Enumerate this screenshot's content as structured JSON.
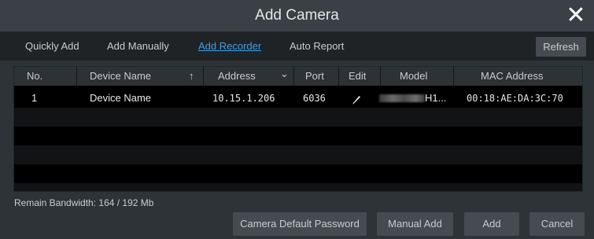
{
  "dialog": {
    "title": "Add Camera",
    "close_glyph": "✕"
  },
  "tabs": [
    {
      "label": "Quickly Add",
      "active": false
    },
    {
      "label": "Add Manually",
      "active": false
    },
    {
      "label": "Add Recorder",
      "active": true
    },
    {
      "label": "Auto Report",
      "active": false
    }
  ],
  "refresh_label": "Refresh",
  "table": {
    "headers": {
      "no": "No.",
      "device_name": "Device Name",
      "sort_arrow": "↑",
      "address": "Address",
      "address_dropdown": "⌄",
      "port": "Port",
      "edit": "Edit",
      "model": "Model",
      "mac": "MAC Address"
    },
    "rows": [
      {
        "no": "1",
        "device_name": "Device Name",
        "address": "10.15.1.206",
        "port": "6036",
        "edit_icon": "pencil-icon",
        "model_suffix": "H1...",
        "mac": "00:18:AE:DA:3C:70"
      }
    ]
  },
  "footer": {
    "bandwidth": "Remain Bandwidth: 164 / 192 Mb",
    "buttons": {
      "camera_default_password": "Camera Default Password",
      "manual_add": "Manual Add",
      "add": "Add",
      "cancel": "Cancel"
    }
  },
  "colors": {
    "accent": "#3b9fe8",
    "background": "#2e3337",
    "title_bar": "#3a4045"
  }
}
